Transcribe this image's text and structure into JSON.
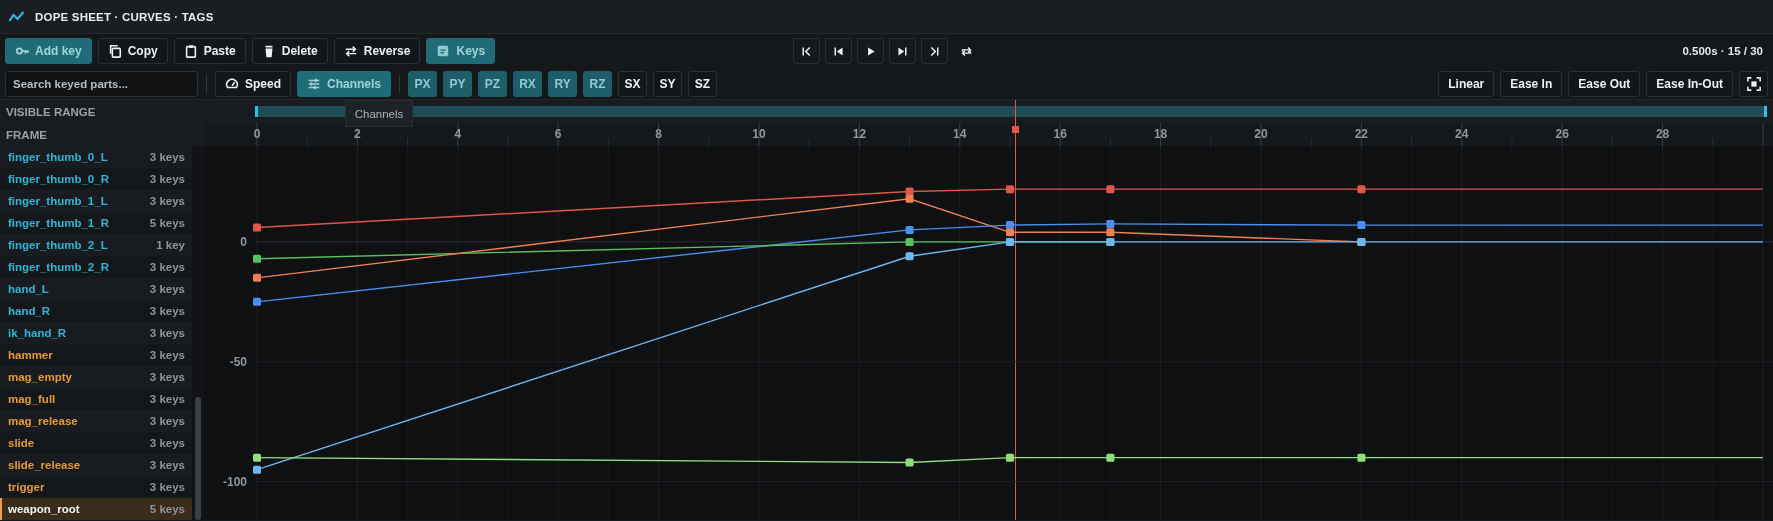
{
  "header": {
    "title": "DOPE SHEET · CURVES · TAGS"
  },
  "toolbar": {
    "buttons": [
      {
        "label": "Add key",
        "kind": "add",
        "active": true
      },
      {
        "label": "Copy",
        "kind": "copy",
        "active": false
      },
      {
        "label": "Paste",
        "kind": "paste",
        "active": false
      },
      {
        "label": "Delete",
        "kind": "delete",
        "active": false
      },
      {
        "label": "Reverse",
        "kind": "reverse",
        "active": false
      },
      {
        "label": "Keys",
        "kind": "keys",
        "active": true
      }
    ],
    "transport": [
      {
        "kind": "first"
      },
      {
        "kind": "prev"
      },
      {
        "kind": "play"
      },
      {
        "kind": "next"
      },
      {
        "kind": "last"
      },
      {
        "kind": "loop"
      }
    ],
    "time": "0.500s · 15 / 30"
  },
  "filter_bar": {
    "search": {
      "placeholder": "Search keyed parts..."
    },
    "speed": {
      "label": "Speed"
    },
    "channels_toggle": {
      "label": "Channels",
      "active": true
    },
    "channels": [
      {
        "label": "PX",
        "on": true
      },
      {
        "label": "PY",
        "on": true
      },
      {
        "label": "PZ",
        "on": true
      },
      {
        "label": "RX",
        "on": true
      },
      {
        "label": "RY",
        "on": true
      },
      {
        "label": "RZ",
        "on": true
      },
      {
        "label": "SX",
        "on": false
      },
      {
        "label": "SY",
        "on": false
      },
      {
        "label": "SZ",
        "on": false
      }
    ],
    "easing": [
      {
        "label": "Linear"
      },
      {
        "label": "Ease In"
      },
      {
        "label": "Ease Out"
      },
      {
        "label": "Ease In-Out"
      }
    ]
  },
  "visible_range": {
    "label": "VISIBLE RANGE"
  },
  "tooltip": "Channels",
  "frame_label": "FRAME",
  "parts": [
    {
      "name": "finger_thumb_0_L",
      "keys": "3 keys",
      "color": "#2fb6d6",
      "selected": false
    },
    {
      "name": "finger_thumb_0_R",
      "keys": "3 keys",
      "color": "#2fb6d6",
      "selected": false
    },
    {
      "name": "finger_thumb_1_L",
      "keys": "3 keys",
      "color": "#2fb6d6",
      "selected": false
    },
    {
      "name": "finger_thumb_1_R",
      "keys": "5 keys",
      "color": "#2fb6d6",
      "selected": false
    },
    {
      "name": "finger_thumb_2_L",
      "keys": "1 key",
      "color": "#2fb6d6",
      "selected": false
    },
    {
      "name": "finger_thumb_2_R",
      "keys": "3 keys",
      "color": "#2fb6d6",
      "selected": false
    },
    {
      "name": "hand_L",
      "keys": "3 keys",
      "color": "#2fb6d6",
      "selected": false
    },
    {
      "name": "hand_R",
      "keys": "3 keys",
      "color": "#2fb6d6",
      "selected": false
    },
    {
      "name": "ik_hand_R",
      "keys": "3 keys",
      "color": "#2fb6d6",
      "selected": false
    },
    {
      "name": "hammer",
      "keys": "3 keys",
      "color": "#e89a30",
      "selected": false
    },
    {
      "name": "mag_empty",
      "keys": "3 keys",
      "color": "#e89a30",
      "selected": false
    },
    {
      "name": "mag_full",
      "keys": "3 keys",
      "color": "#e89a30",
      "selected": false
    },
    {
      "name": "mag_release",
      "keys": "3 keys",
      "color": "#e89a30",
      "selected": false
    },
    {
      "name": "slide",
      "keys": "3 keys",
      "color": "#e89a30",
      "selected": false
    },
    {
      "name": "slide_release",
      "keys": "3 keys",
      "color": "#e89a30",
      "selected": false
    },
    {
      "name": "trigger",
      "keys": "3 keys",
      "color": "#e89a30",
      "selected": false
    },
    {
      "name": "weapon_root",
      "keys": "5 keys",
      "selected": true
    }
  ],
  "graph": {
    "chart_data": {
      "type": "line",
      "grid": true,
      "x": [
        0,
        13,
        15,
        17,
        22,
        30
      ],
      "series": [
        {
          "color": "#e0574a",
          "marker": "square",
          "values": [
            6,
            21,
            22,
            22,
            22,
            22
          ]
        },
        {
          "color": "#f08050",
          "marker": "square",
          "values": [
            -15,
            18,
            4,
            4,
            0,
            null
          ]
        },
        {
          "color": "#4a8ef0",
          "marker": "square",
          "values": [
            -25,
            5,
            7,
            7.5,
            7,
            7
          ]
        },
        {
          "color": "#58c060",
          "marker": "square",
          "values": [
            -7,
            0,
            0,
            0,
            null,
            null
          ]
        },
        {
          "color": "#6cb8f4",
          "marker": "square",
          "values": [
            -95,
            -6,
            0,
            0,
            0,
            0
          ]
        },
        {
          "color": "#8ee07a",
          "marker": "square",
          "values": [
            -90,
            -92,
            -90,
            -90,
            -90,
            -90
          ]
        }
      ],
      "xlim": [
        0,
        30.2
      ],
      "ylim": [
        -116,
        40
      ],
      "xticks": [
        0,
        2,
        4,
        6,
        8,
        10,
        12,
        14,
        16,
        18,
        20,
        22,
        24,
        26,
        28
      ],
      "yticks": [
        0,
        -50,
        -100
      ]
    }
  }
}
